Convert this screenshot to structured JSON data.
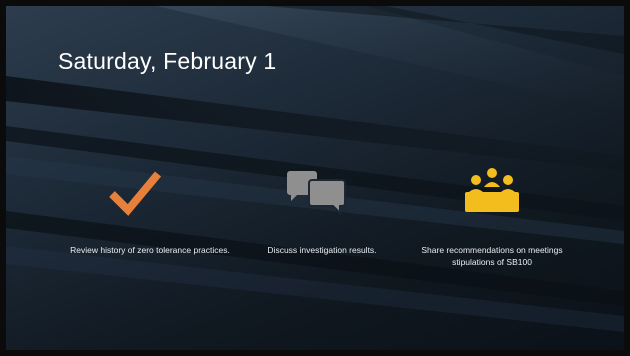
{
  "slide": {
    "title": "Saturday, February 1",
    "items": [
      {
        "icon": "checkmark-icon",
        "color": "#e8803a",
        "caption": "Review history of zero tolerance practices."
      },
      {
        "icon": "speech-bubbles-icon",
        "color": "#8f8f8f",
        "caption": "Discuss investigation results."
      },
      {
        "icon": "meeting-group-icon",
        "color": "#f2bd1d",
        "caption": "Share recommendations on meetings stipulations of SB100"
      }
    ]
  }
}
